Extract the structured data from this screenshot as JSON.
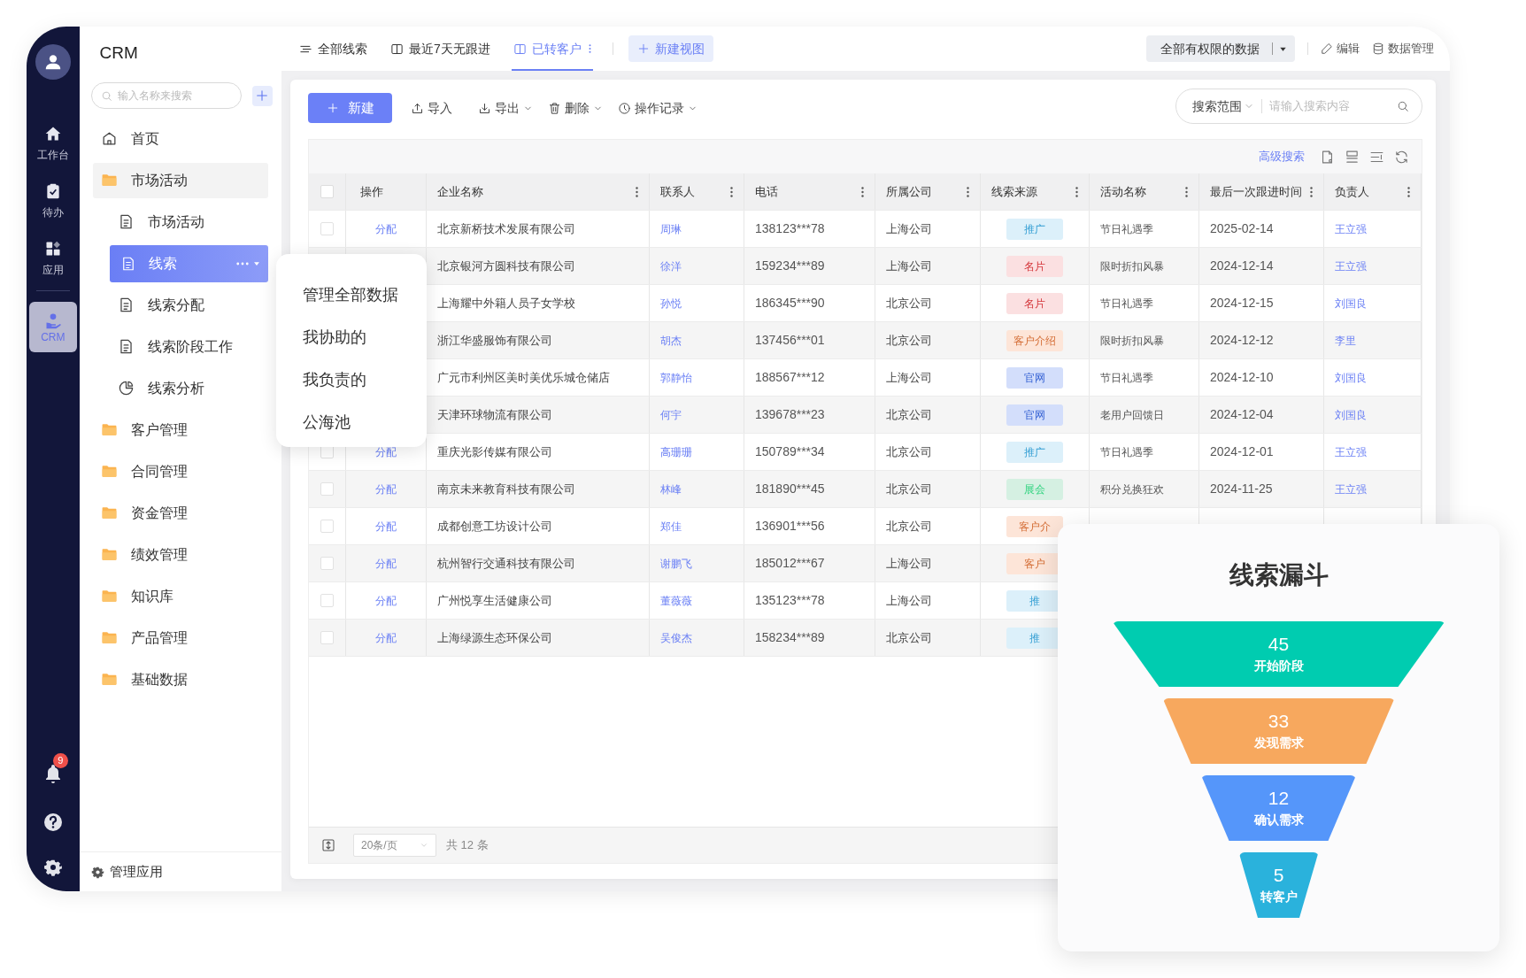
{
  "rail": {
    "items": [
      {
        "label": "工作台",
        "kind": "home",
        "selected": false
      },
      {
        "label": "待办",
        "kind": "todo",
        "selected": false
      },
      {
        "label": "应用",
        "kind": "apps",
        "selected": false
      },
      {
        "label": "CRM",
        "kind": "crm",
        "selected": true
      }
    ],
    "notification_badge": "9"
  },
  "sidebar": {
    "title": "CRM",
    "search_placeholder": "输入名称来搜索",
    "items": [
      {
        "label": "首页",
        "kind": "home",
        "selected": false
      },
      {
        "label": "市场活动",
        "kind": "folder",
        "selected": false,
        "expanded": true,
        "children": [
          {
            "label": "市场活动",
            "kind": "doc",
            "selected": false
          },
          {
            "label": "线索",
            "kind": "doc",
            "selected": true
          },
          {
            "label": "线索分配",
            "kind": "doc",
            "selected": false
          },
          {
            "label": "线索阶段工作",
            "kind": "doc",
            "selected": false
          },
          {
            "label": "线索分析",
            "kind": "pie",
            "selected": false
          }
        ]
      },
      {
        "label": "客户管理",
        "kind": "folder",
        "selected": false,
        "expanded": false
      },
      {
        "label": "合同管理",
        "kind": "folder",
        "selected": false,
        "expanded": false
      },
      {
        "label": "资金管理",
        "kind": "folder",
        "selected": false,
        "expanded": false
      },
      {
        "label": "绩效管理",
        "kind": "folder",
        "selected": false,
        "expanded": false
      },
      {
        "label": "知识库",
        "kind": "folder",
        "selected": false,
        "expanded": false
      },
      {
        "label": "产品管理",
        "kind": "folder",
        "selected": false,
        "expanded": false
      },
      {
        "label": "基础数据",
        "kind": "folder",
        "selected": false,
        "expanded": false
      }
    ],
    "footer": "管理应用"
  },
  "context_menu": {
    "items": [
      "管理全部数据",
      "我协助的",
      "我负责的",
      "公海池"
    ]
  },
  "view_tabs": [
    {
      "label": "全部线索",
      "kind": "list",
      "selected": false
    },
    {
      "label": "最近7天无跟进",
      "kind": "columns",
      "selected": false
    },
    {
      "label": "已转客户",
      "kind": "columns",
      "selected": true
    }
  ],
  "new_view": "新建视图",
  "top_right": {
    "scope": "全部有权限的数据",
    "edit": "编辑",
    "data_manage": "数据管理"
  },
  "toolbar": {
    "new": "新建",
    "import": "导入",
    "export": "导出",
    "delete": "删除",
    "history": "操作记录",
    "search_scope": "搜索范围",
    "search_placeholder": "请输入搜索内容",
    "advanced_search": "高级搜索"
  },
  "table": {
    "header_checked": false,
    "columns": [
      "操作",
      "企业名称",
      "联系人",
      "电话",
      "所属公司",
      "线索来源",
      "活动名称",
      "最后一次跟进时间",
      "负责人"
    ],
    "rows": [
      {
        "checked": false,
        "action": "分配",
        "company": "北京新桥技术发展有限公司",
        "contact": "周琳",
        "phone": "138123***78",
        "branch": "上海公司",
        "source": {
          "label": "推广",
          "color": "#dcf0fa"
        },
        "activity": "节日礼遇季",
        "last_follow_up": "2025-02-14",
        "owner": "王立强"
      },
      {
        "company": "北京银河方圆科技有限公司",
        "contact": "徐洋",
        "phone": "159234***89",
        "branch": "上海公司",
        "source": {
          "label": "名片",
          "color": "#fbe0e1"
        },
        "activity": "限时折扣风暴",
        "last_follow_up": "2024-12-14",
        "owner": "王立强"
      },
      {
        "company": "上海耀中外籍人员子女学校",
        "contact": "孙悦",
        "phone": "186345***90",
        "branch": "北京公司",
        "source": {
          "label": "名片",
          "color": "#fbe0e1"
        },
        "activity": "节日礼遇季",
        "last_follow_up": "2024-12-15",
        "owner": "刘国良"
      },
      {
        "company": "浙江华盛服饰有限公司",
        "contact": "胡杰",
        "phone": "137456***01",
        "branch": "北京公司",
        "source": {
          "label": "客户介绍",
          "color": "#fde5d8"
        },
        "activity": "限时折扣风暴",
        "last_follow_up": "2024-12-12",
        "owner": "李里"
      },
      {
        "company": "广元市利州区美时美优乐城仓储店",
        "contact": "郭静怡",
        "phone": "188567***12",
        "branch": "上海公司",
        "source": {
          "label": "官网",
          "color": "#d3defb"
        },
        "activity": "节日礼遇季",
        "last_follow_up": "2024-12-10",
        "owner": "刘国良"
      },
      {
        "company": "天津环球物流有限公司",
        "contact": "何宇",
        "phone": "139678***23",
        "branch": "北京公司",
        "source": {
          "label": "官网",
          "color": "#d3defb"
        },
        "activity": "老用户回馈日",
        "last_follow_up": "2024-12-04",
        "owner": "刘国良"
      },
      {
        "checked": false,
        "action": "分配",
        "company": "重庆光影传媒有限公司",
        "contact": "高珊珊",
        "phone": "150789***34",
        "branch": "北京公司",
        "source": {
          "label": "推广",
          "color": "#dcf0fa"
        },
        "activity": "节日礼遇季",
        "last_follow_up": "2024-12-01",
        "owner": "王立强"
      },
      {
        "checked": false,
        "action": "分配",
        "company": "南京未来教育科技有限公司",
        "contact": "林峰",
        "phone": "181890***45",
        "branch": "北京公司",
        "source": {
          "label": "展会",
          "color": "#d5f0e2"
        },
        "activity": "积分兑换狂欢",
        "last_follow_up": "2024-11-25",
        "owner": "王立强"
      },
      {
        "checked": false,
        "action": "分配",
        "company": "成都创意工坊设计公司",
        "contact": "郑佳",
        "phone": "136901***56",
        "branch": "北京公司",
        "source": {
          "label": "客户介",
          "color": "#fde5d8"
        }
      },
      {
        "checked": false,
        "action": "分配",
        "company": "杭州智行交通科技有限公司",
        "contact": "谢鹏飞",
        "phone": "185012***67",
        "branch": "上海公司",
        "source": {
          "label": "客户",
          "color": "#fde5d8"
        }
      },
      {
        "checked": false,
        "action": "分配",
        "company": "广州悦享生活健康公司",
        "contact": "董薇薇",
        "phone": "135123***78",
        "branch": "上海公司",
        "source": {
          "label": "推",
          "color": "#dcf0fa"
        }
      },
      {
        "checked": false,
        "action": "分配",
        "company": "上海绿源生态环保公司",
        "contact": "吴俊杰",
        "phone": "158234***89",
        "branch": "北京公司",
        "source": {
          "label": "推",
          "color": "#dcf0fa"
        }
      }
    ]
  },
  "footer": {
    "page_size": "20条/页",
    "total": "共 12 条"
  },
  "funnel": {
    "title": "线索漏斗",
    "stages": [
      {
        "count": "45",
        "label": "开始阶段",
        "color": "#00ccb0"
      },
      {
        "count": "33",
        "label": "发现需求",
        "color": "#f7a85e"
      },
      {
        "count": "12",
        "label": "确认需求",
        "color": "#5596fa"
      },
      {
        "count": "5",
        "label": "转客户",
        "color": "#2ab2dc"
      }
    ]
  }
}
